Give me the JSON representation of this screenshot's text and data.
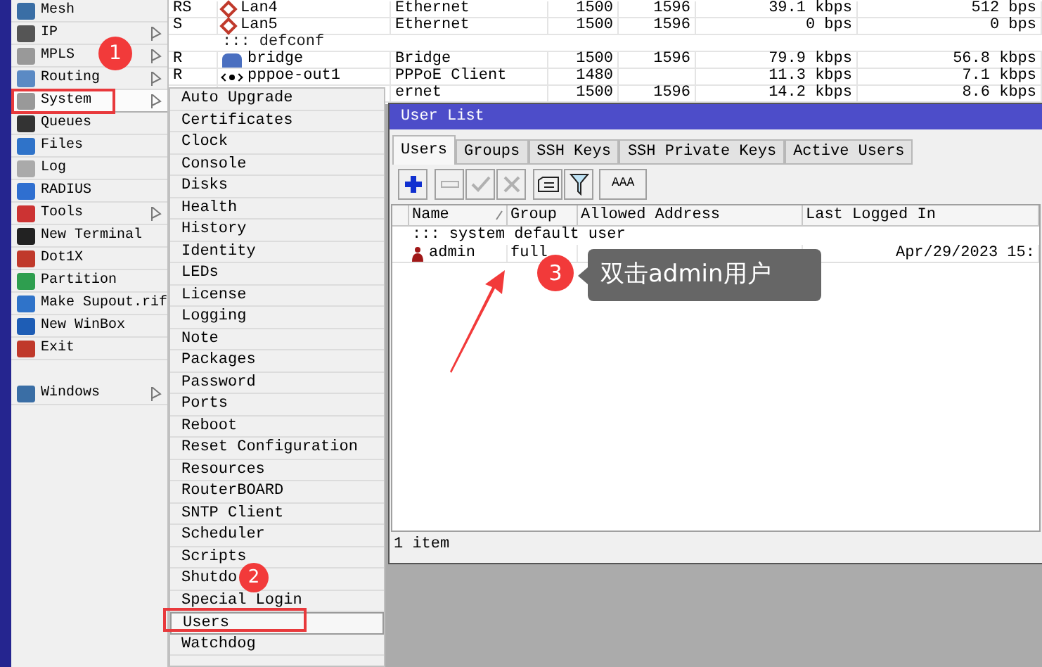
{
  "sidebar": {
    "items": [
      {
        "label": "Mesh",
        "submenu": false,
        "selected": false
      },
      {
        "label": "IP",
        "submenu": true,
        "selected": false
      },
      {
        "label": "MPLS",
        "submenu": true,
        "selected": false
      },
      {
        "label": "Routing",
        "submenu": true,
        "selected": false
      },
      {
        "label": "System",
        "submenu": true,
        "selected": true
      },
      {
        "label": "Queues",
        "submenu": false,
        "selected": false
      },
      {
        "label": "Files",
        "submenu": false,
        "selected": false
      },
      {
        "label": "Log",
        "submenu": false,
        "selected": false
      },
      {
        "label": "RADIUS",
        "submenu": false,
        "selected": false
      },
      {
        "label": "Tools",
        "submenu": true,
        "selected": false
      },
      {
        "label": "New Terminal",
        "submenu": false,
        "selected": false
      },
      {
        "label": "Dot1X",
        "submenu": false,
        "selected": false
      },
      {
        "label": "Partition",
        "submenu": false,
        "selected": false
      },
      {
        "label": "Make Supout.rif",
        "submenu": false,
        "selected": false
      },
      {
        "label": "New WinBox",
        "submenu": false,
        "selected": false
      },
      {
        "label": "Exit",
        "submenu": false,
        "selected": false
      }
    ],
    "bottom_items": [
      {
        "label": "Windows",
        "submenu": true,
        "selected": false
      }
    ]
  },
  "interfaces": {
    "rows": [
      {
        "kind": "port",
        "cells": [
          "RS",
          "Lan4",
          "Ethernet",
          "1500",
          "1596",
          "39.1 kbps",
          "512 bps"
        ]
      },
      {
        "kind": "port",
        "cells": [
          "S",
          "Lan5",
          "Ethernet",
          "1500",
          "1596",
          "0 bps",
          "0 bps"
        ]
      },
      {
        "kind": "comment",
        "cells": [
          "",
          "::: defconf"
        ]
      },
      {
        "kind": "bridge",
        "cells": [
          "R",
          "bridge",
          "Bridge",
          "1500",
          "1596",
          "79.9 kbps",
          "56.8 kbps"
        ]
      },
      {
        "kind": "tunnel",
        "cells": [
          "R",
          "pppoe-out1",
          "PPPoE Client",
          "1480",
          "",
          "11.3 kbps",
          "7.1 kbps"
        ]
      },
      {
        "kind": "covered",
        "cells": [
          "",
          "",
          "ernet",
          "1500",
          "1596",
          "14.2 kbps",
          "8.6 kbps"
        ]
      }
    ]
  },
  "system_menu": {
    "items": [
      {
        "label": "Auto Upgrade",
        "selected": false
      },
      {
        "label": "Certificates",
        "selected": false
      },
      {
        "label": "Clock",
        "selected": false
      },
      {
        "label": "Console",
        "selected": false
      },
      {
        "label": "Disks",
        "selected": false
      },
      {
        "label": "Health",
        "selected": false
      },
      {
        "label": "History",
        "selected": false
      },
      {
        "label": "Identity",
        "selected": false
      },
      {
        "label": "LEDs",
        "selected": false
      },
      {
        "label": "License",
        "selected": false
      },
      {
        "label": "Logging",
        "selected": false
      },
      {
        "label": "Note",
        "selected": false
      },
      {
        "label": "Packages",
        "selected": false
      },
      {
        "label": "Password",
        "selected": false
      },
      {
        "label": "Ports",
        "selected": false
      },
      {
        "label": "Reboot",
        "selected": false
      },
      {
        "label": "Reset Configuration",
        "selected": false
      },
      {
        "label": "Resources",
        "selected": false
      },
      {
        "label": "RouterBOARD",
        "selected": false
      },
      {
        "label": "SNTP Client",
        "selected": false
      },
      {
        "label": "Scheduler",
        "selected": false
      },
      {
        "label": "Scripts",
        "selected": false
      },
      {
        "label": "Shutdo",
        "selected": false
      },
      {
        "label": "Special Login",
        "selected": false
      },
      {
        "label": "Users",
        "selected": true
      },
      {
        "label": "Watchdog",
        "selected": false
      }
    ]
  },
  "user_list": {
    "title": "User List",
    "tabs": [
      {
        "label": "Users",
        "selected": true
      },
      {
        "label": "Groups",
        "selected": false
      },
      {
        "label": "SSH Keys",
        "selected": false
      },
      {
        "label": "SSH Private Keys",
        "selected": false
      },
      {
        "label": "Active Users",
        "selected": false
      }
    ],
    "toolbar": [
      {
        "kind": "add",
        "disabled": false
      },
      {
        "kind": "remove",
        "disabled": true
      },
      {
        "kind": "enable",
        "disabled": true
      },
      {
        "kind": "disable",
        "disabled": true
      },
      {
        "kind": "comment",
        "disabled": false
      },
      {
        "kind": "filter",
        "disabled": false
      },
      {
        "kind": "text",
        "label": "AAA",
        "disabled": false
      }
    ],
    "columns": [
      "Name",
      "Group",
      "Allowed Address",
      "Last Logged In"
    ],
    "rows": [
      {
        "kind": "comment",
        "cells": [
          "::: system default user"
        ]
      },
      {
        "kind": "user",
        "cells": [
          "admin",
          "full",
          "",
          "Apr/29/2023 15:"
        ]
      }
    ],
    "status": "1 item"
  },
  "annotations": {
    "badges": [
      "1",
      "2",
      "3"
    ],
    "callout": "双击admin用户"
  }
}
